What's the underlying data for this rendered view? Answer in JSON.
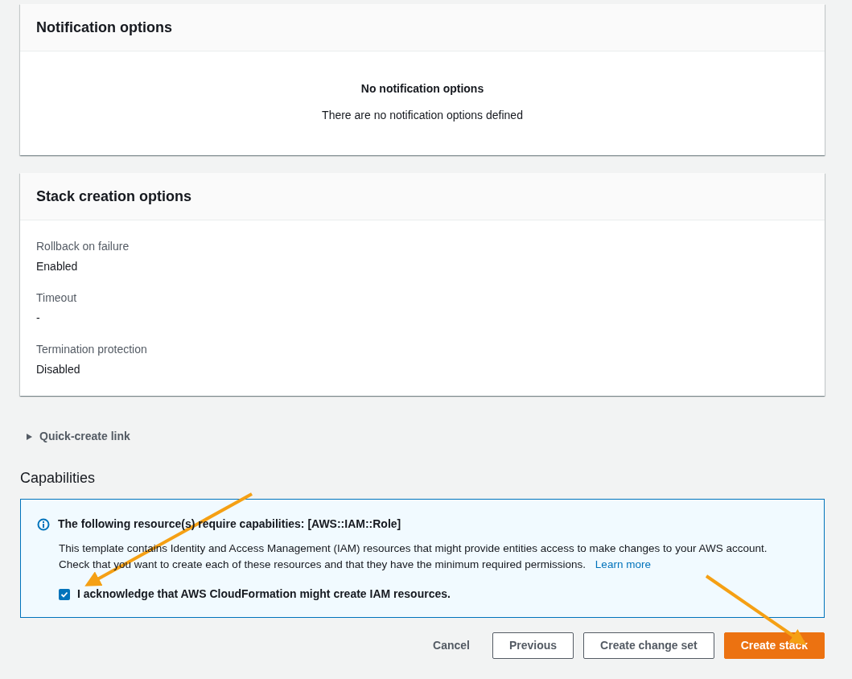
{
  "notification_options": {
    "title": "Notification options",
    "empty_title": "No notification options",
    "empty_text": "There are no notification options defined"
  },
  "stack_creation_options": {
    "title": "Stack creation options",
    "fields": [
      {
        "label": "Rollback on failure",
        "value": "Enabled"
      },
      {
        "label": "Timeout",
        "value": "-"
      },
      {
        "label": "Termination protection",
        "value": "Disabled"
      }
    ]
  },
  "quick_create_link": {
    "label": "Quick-create link",
    "expanded": false
  },
  "capabilities": {
    "title": "Capabilities",
    "info_title": "The following resource(s) require capabilities: [AWS::IAM::Role]",
    "info_text": "This template contains Identity and Access Management (IAM) resources that might provide entities access to make changes to your AWS account. Check that you want to create each of these resources and that they have the minimum required permissions.",
    "learn_more": "Learn more",
    "acknowledge": {
      "label": "I acknowledge that AWS CloudFormation might create IAM resources.",
      "checked": true
    }
  },
  "buttons": [
    {
      "label": "Cancel",
      "kind": "link"
    },
    {
      "label": "Previous",
      "kind": "normal"
    },
    {
      "label": "Create change set",
      "kind": "normal"
    },
    {
      "label": "Create stack",
      "kind": "primary"
    }
  ]
}
